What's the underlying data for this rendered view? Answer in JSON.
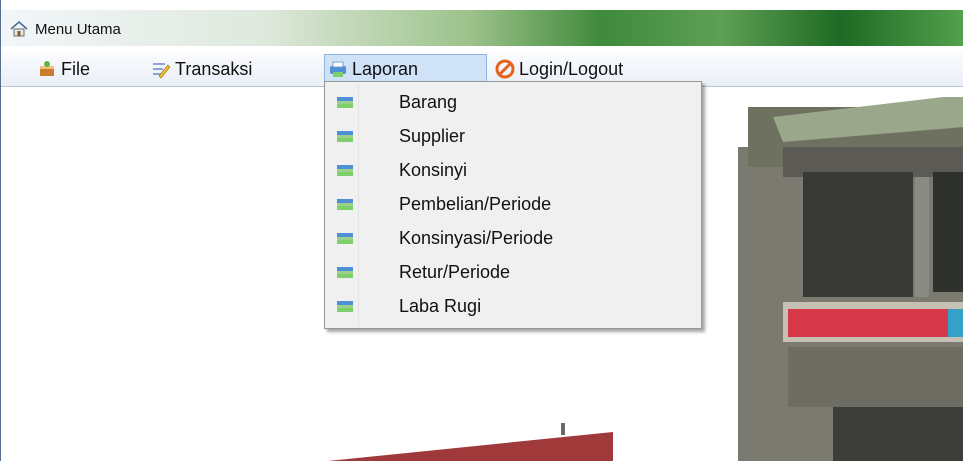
{
  "window": {
    "title": "Menu Utama",
    "title_icon": "home-icon"
  },
  "menubar": {
    "items": [
      {
        "label": "File",
        "icon": "file-cake-icon"
      },
      {
        "label": "Transaksi",
        "icon": "pencil-edit-icon"
      },
      {
        "label": "Laporan",
        "icon": "printer-icon",
        "active": true
      },
      {
        "label": "Login/Logout",
        "icon": "no-entry-icon"
      }
    ]
  },
  "dropdown": {
    "items": [
      {
        "label": "Barang",
        "icon": "printer-icon"
      },
      {
        "label": "Supplier",
        "icon": "printer-icon"
      },
      {
        "label": "Konsinyi",
        "icon": "printer-icon"
      },
      {
        "label": "Pembelian/Periode",
        "icon": "printer-icon"
      },
      {
        "label": "Konsinyasi/Periode",
        "icon": "printer-icon"
      },
      {
        "label": "Retur/Periode",
        "icon": "printer-icon"
      },
      {
        "label": "Laba Rugi",
        "icon": "printer-icon"
      }
    ]
  },
  "colors": {
    "menu_highlight": "#cfe2f7",
    "titlebar_green": "#3f8a3c",
    "dropdown_bg": "#f0f0f0"
  }
}
